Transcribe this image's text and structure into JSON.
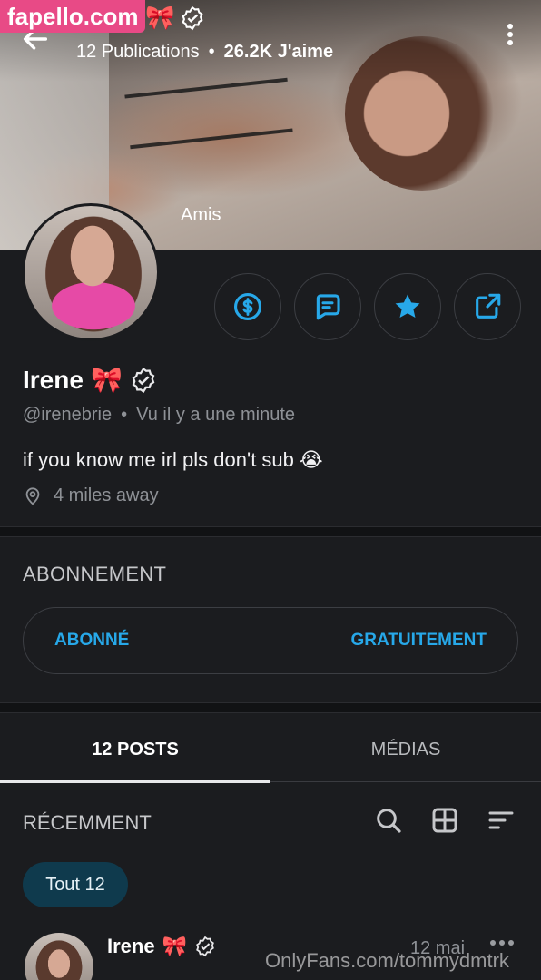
{
  "watermark_top": "fapello.com",
  "header": {
    "publications": "12 Publications",
    "likes": "26.2K J'aime"
  },
  "cover": {
    "label": "Amis"
  },
  "profile": {
    "name": "Irene",
    "bow": "🎀",
    "handle": "@irenebrie",
    "last_seen": "Vu  il y a une minute",
    "bio": "if you know me irl pls don't sub 😭",
    "location": "4 miles away"
  },
  "subscription": {
    "title": "ABONNEMENT",
    "status": "ABONNÉ",
    "price": "GRATUITEMENT"
  },
  "tabs": [
    {
      "label": "12 POSTS"
    },
    {
      "label": "MÉDIAS"
    }
  ],
  "feed": {
    "section_title": "RÉCEMMENT",
    "filter_chip": "Tout 12"
  },
  "post": {
    "author": "Irene",
    "bow": "🎀",
    "date": "12 mai"
  },
  "watermark_bottom": "OnlyFans.com/tommydmtrk",
  "colors": {
    "accent": "#27a8e9",
    "background": "#1b1c1f",
    "watermark_pink": "#e84a86"
  }
}
